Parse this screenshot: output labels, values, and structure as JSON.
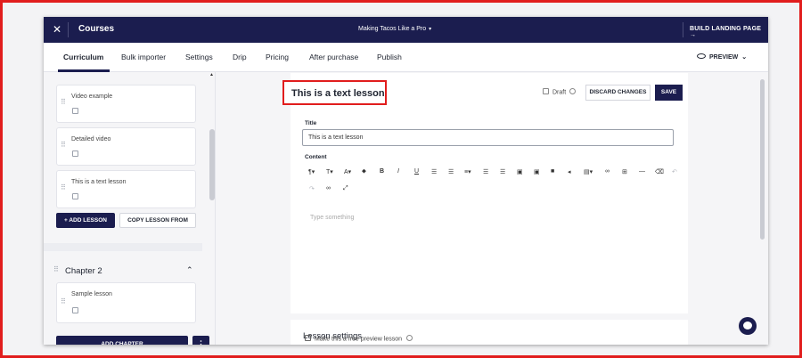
{
  "header": {
    "close_icon": "close-icon",
    "title": "Courses",
    "course_name": "Making Tacos Like a Pro",
    "course_caret": "▾",
    "landing_button": "BUILD LANDING PAGE",
    "landing_arrow": "→"
  },
  "tabs": [
    "Curriculum",
    "Bulk importer",
    "Settings",
    "Drip",
    "Pricing",
    "After purchase",
    "Publish"
  ],
  "preview_label": "PREVIEW",
  "sidebar": {
    "lessons": [
      {
        "label": "Video example",
        "icon": "video-icon"
      },
      {
        "label": "Detailed video",
        "icon": "video-icon"
      },
      {
        "label": "This is a text lesson",
        "icon": "document-icon"
      }
    ],
    "add_lesson": "+ ADD LESSON",
    "copy_lesson": "COPY LESSON FROM",
    "chapter2_title": "Chapter 2",
    "chapter2_lessons": [
      {
        "label": "Sample lesson",
        "icon": "document-icon"
      }
    ],
    "add_chapter": "ADD CHAPTER",
    "more_menu": "⋮"
  },
  "editor": {
    "heading": "This is a text lesson",
    "draft_label": "Draft",
    "discard_label": "DISCARD CHANGES",
    "save_label": "SAVE",
    "title_label": "Title",
    "title_value": "This is a text lesson",
    "content_label": "Content",
    "placeholder": "Type something",
    "toolbar_row1": [
      "¶▾",
      "T▾",
      "A▾",
      "⬥",
      "B",
      "I",
      "U",
      "☰",
      "☰",
      "≡▾",
      "☰",
      "☰",
      "▣",
      "▣",
      "■",
      "◂",
      "▤▾",
      "∞",
      "⊞",
      "—",
      "⌫",
      "↶"
    ],
    "toolbar_row2": [
      "↷",
      "∞",
      "⤢"
    ]
  },
  "settings": {
    "heading": "Lesson settings",
    "free_preview": "Make this a free preview lesson"
  }
}
